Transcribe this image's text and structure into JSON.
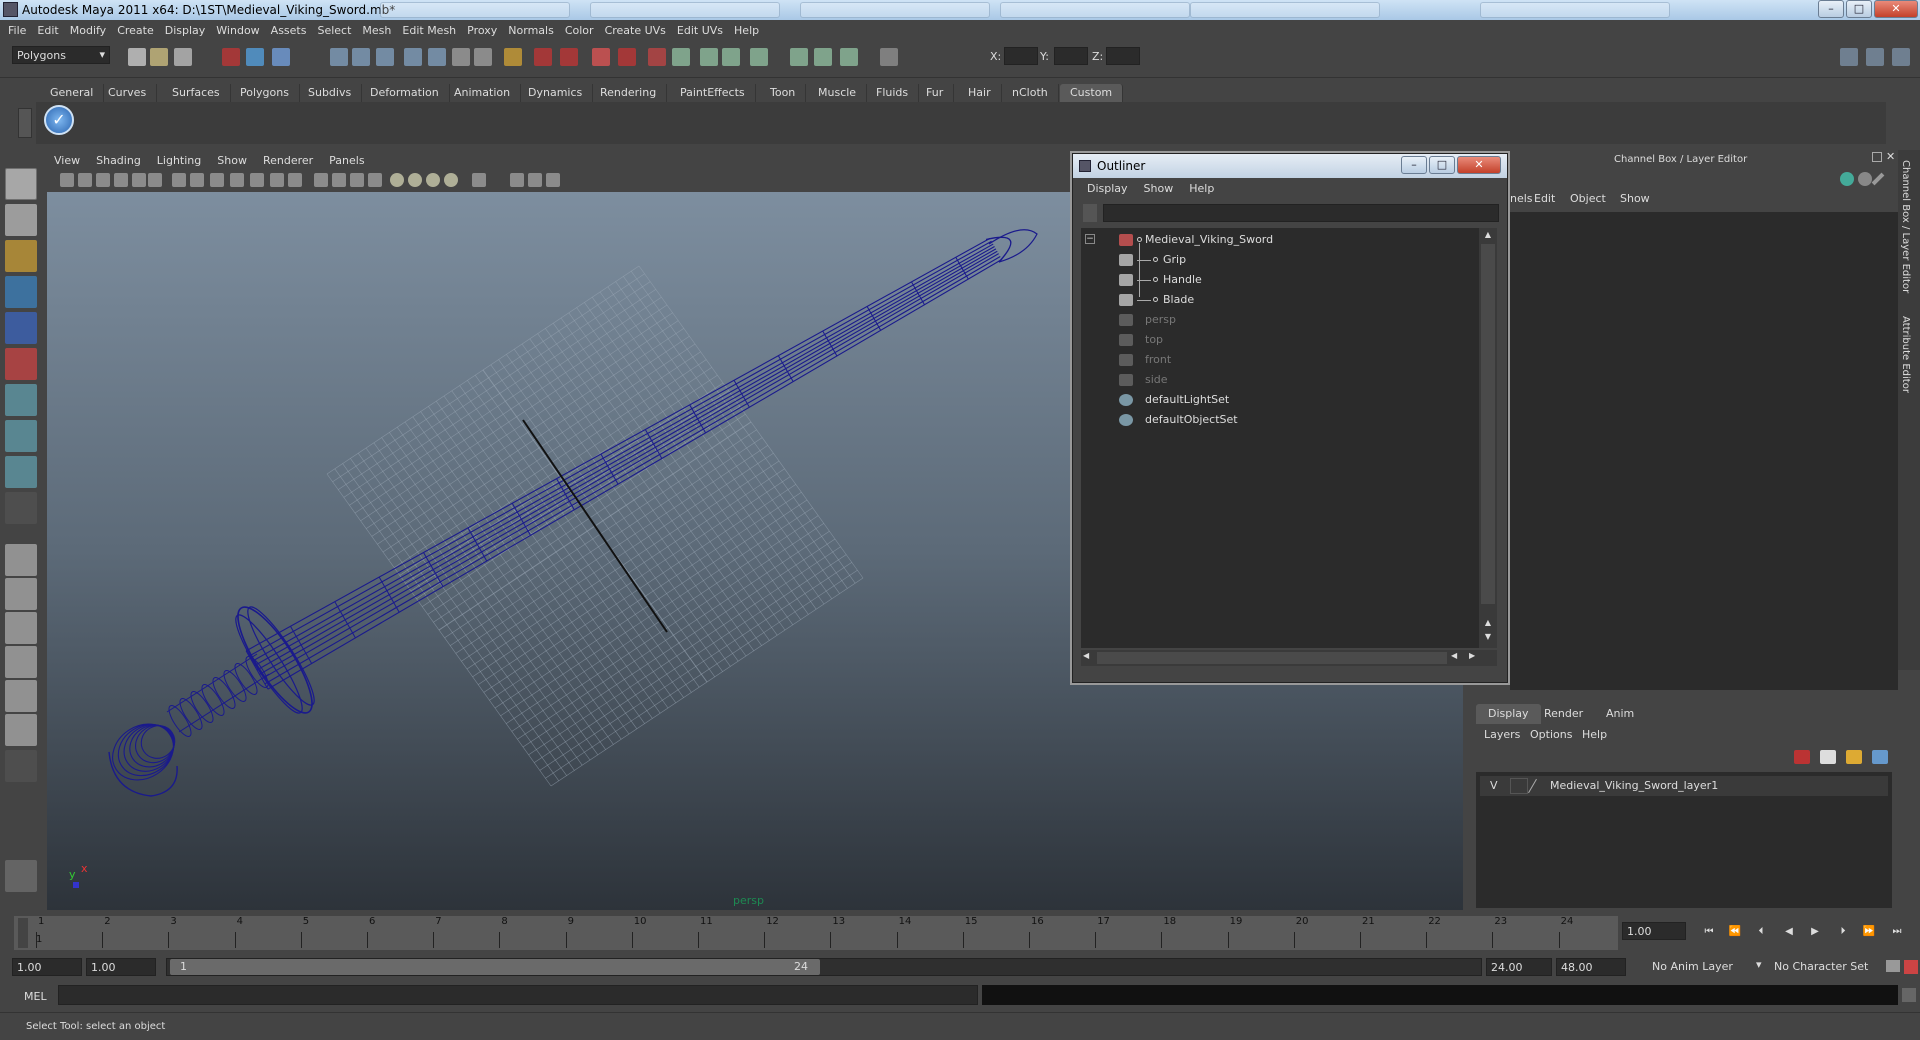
{
  "window": {
    "title": "Autodesk Maya 2011 x64: D:\\1ST\\Medieval_Viking_Sword.mb*",
    "minimize": "–",
    "maximize": "□",
    "close": "✕"
  },
  "menubar": [
    "File",
    "Edit",
    "Modify",
    "Create",
    "Display",
    "Window",
    "Assets",
    "Select",
    "Mesh",
    "Edit Mesh",
    "Proxy",
    "Normals",
    "Color",
    "Create UVs",
    "Edit UVs",
    "Help"
  ],
  "statusline": {
    "mode": "Polygons",
    "x_label": "X:",
    "y_label": "Y:",
    "z_label": "Z:"
  },
  "shelf": {
    "tabs": [
      "General",
      "Curves",
      "Surfaces",
      "Polygons",
      "Subdivs",
      "Deformation",
      "Animation",
      "Dynamics",
      "Rendering",
      "PaintEffects",
      "Toon",
      "Muscle",
      "Fluids",
      "Fur",
      "Hair",
      "nCloth",
      "Custom"
    ],
    "active": "Custom"
  },
  "viewport": {
    "menu": [
      "View",
      "Shading",
      "Lighting",
      "Show",
      "Renderer",
      "Panels"
    ],
    "camera_label": "persp",
    "axis_x": "x",
    "axis_y": "y"
  },
  "outliner": {
    "title": "Outliner",
    "menu": [
      "Display",
      "Show",
      "Help"
    ],
    "items": [
      {
        "label": "Medieval_Viking_Sword",
        "indent": 0,
        "icon": "transform-icon",
        "dim": false
      },
      {
        "label": "Grip",
        "indent": 1,
        "icon": "mesh-icon",
        "dim": false
      },
      {
        "label": "Handle",
        "indent": 1,
        "icon": "mesh-icon",
        "dim": false
      },
      {
        "label": "Blade",
        "indent": 1,
        "icon": "mesh-icon",
        "dim": false
      },
      {
        "label": "persp",
        "indent": 0,
        "icon": "camera-icon",
        "dim": true
      },
      {
        "label": "top",
        "indent": 0,
        "icon": "camera-icon",
        "dim": true
      },
      {
        "label": "front",
        "indent": 0,
        "icon": "camera-icon",
        "dim": true
      },
      {
        "label": "side",
        "indent": 0,
        "icon": "camera-icon",
        "dim": true
      },
      {
        "label": "defaultLightSet",
        "indent": 0,
        "icon": "set-icon",
        "dim": false
      },
      {
        "label": "defaultObjectSet",
        "indent": 0,
        "icon": "set-icon",
        "dim": false
      }
    ],
    "collapse": "−"
  },
  "channelbox": {
    "title": "Channel Box / Layer Editor",
    "menu": [
      "nels",
      "Edit",
      "Object",
      "Show"
    ]
  },
  "layers": {
    "tabs": [
      "Display",
      "Render",
      "Anim"
    ],
    "active": "Display",
    "menu": [
      "Layers",
      "Options",
      "Help"
    ],
    "layer": {
      "visible": "V",
      "name": "Medieval_Viking_Sword_layer1"
    }
  },
  "sidetabs": [
    "Channel Box / Layer Editor",
    "Attribute Editor"
  ],
  "timeline": {
    "frames": [
      "1",
      "2",
      "3",
      "4",
      "5",
      "6",
      "7",
      "8",
      "9",
      "10",
      "11",
      "12",
      "13",
      "14",
      "15",
      "16",
      "17",
      "18",
      "19",
      "20",
      "21",
      "22",
      "23",
      "24"
    ],
    "current_marker": "1",
    "current_frame": "1.00"
  },
  "range": {
    "start": "1.00",
    "playback_start": "1.00",
    "handle_start": "1",
    "handle_end": "24",
    "playback_end": "24.00",
    "end": "48.00",
    "anim_layer": "No Anim Layer",
    "char_set": "No Character Set"
  },
  "cmdline": {
    "label": "MEL"
  },
  "helpline": {
    "text": "Select Tool: select an object"
  },
  "colors": {
    "wire": "#1a1a8c",
    "grid": "#9aa7b5",
    "accent": "#5a5a5a"
  }
}
